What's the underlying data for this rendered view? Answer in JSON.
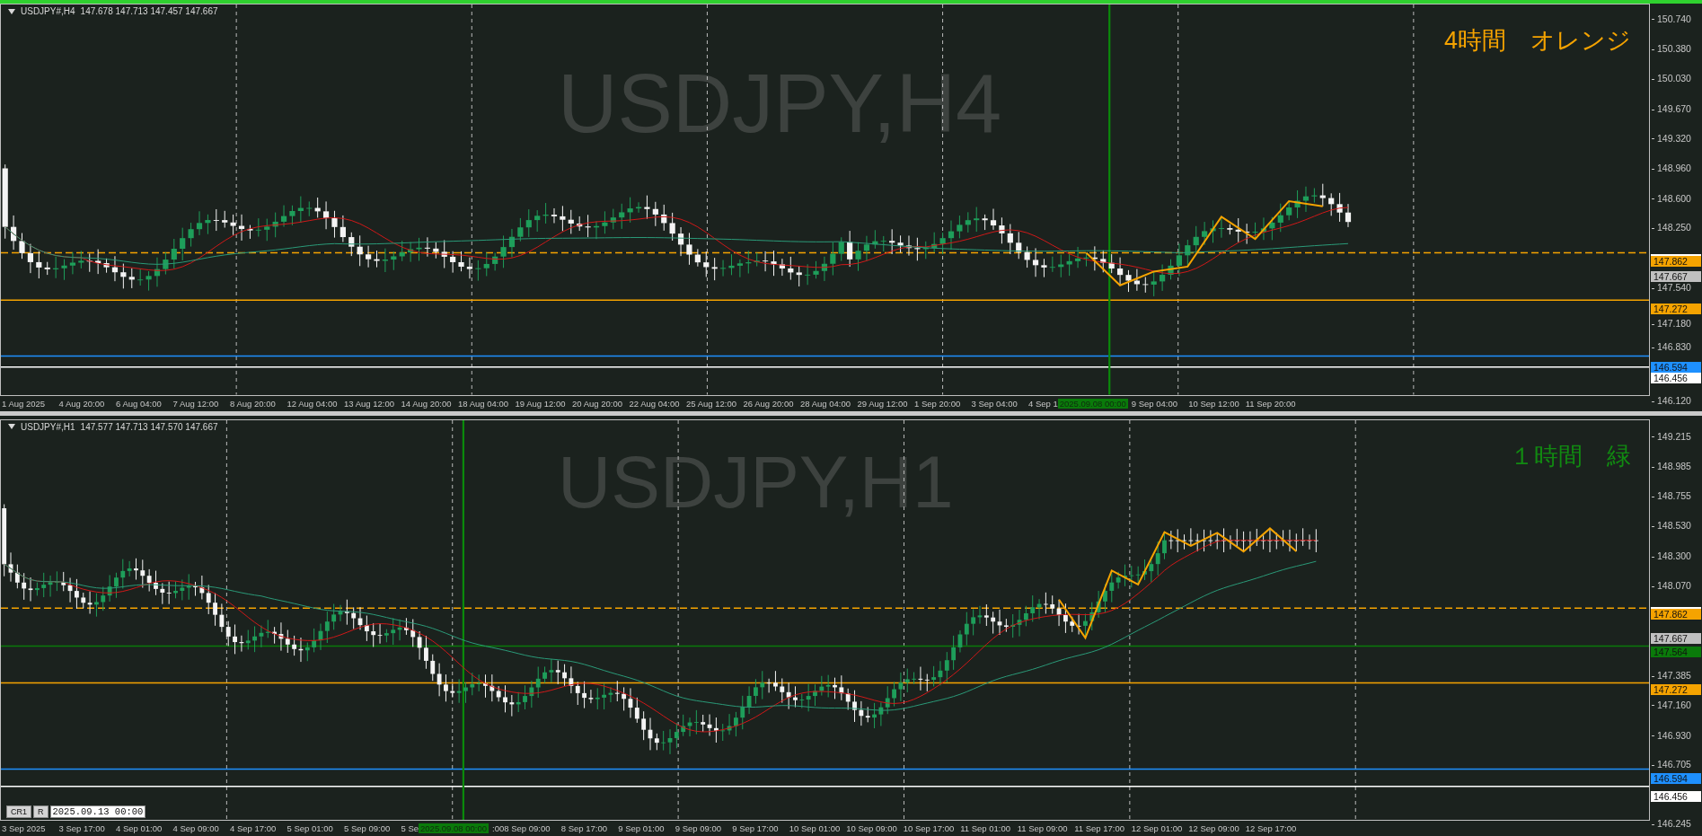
{
  "panels": [
    {
      "active": true,
      "symbol": "USDJPY#,H4",
      "ohlc": "147.678 147.713 147.457 147.667",
      "watermark": "USDJPY,H4",
      "note": {
        "text": "4時間　オレンジ",
        "color": "#f5a300"
      },
      "price_labels": [
        {
          "text": "150.740",
          "kind": "tick"
        },
        {
          "text": "150.380",
          "kind": "tick"
        },
        {
          "text": "150.030",
          "kind": "tick"
        },
        {
          "text": "149.670",
          "kind": "tick"
        },
        {
          "text": "149.320",
          "kind": "tick"
        },
        {
          "text": "148.960",
          "kind": "tick"
        },
        {
          "text": "148.600",
          "kind": "tick"
        },
        {
          "text": "148.250",
          "kind": "tick"
        },
        {
          "text": "147.862",
          "kind": "level",
          "color": "#f5a300",
          "dashed": true
        },
        {
          "text": "147.667",
          "kind": "price",
          "color": "#c0c0c0"
        },
        {
          "text": "147.540",
          "kind": "tick"
        },
        {
          "text": "147.272",
          "kind": "level",
          "color": "#f5a300",
          "dashed": false
        },
        {
          "text": "147.180",
          "kind": "tick"
        },
        {
          "text": "146.830",
          "kind": "tick"
        },
        {
          "text": "146.594",
          "kind": "level",
          "color": "#1e90ff",
          "dashed": false
        },
        {
          "text": "146.456",
          "kind": "level",
          "color": "#ffffff",
          "dashed": false
        },
        {
          "text": "146.120",
          "kind": "tick"
        }
      ],
      "time_labels": [
        {
          "text": "1 Aug 2025",
          "kind": "label"
        },
        {
          "text": "4 Aug 20:00",
          "kind": "label"
        },
        {
          "text": "6 Aug 04:00",
          "kind": "label"
        },
        {
          "text": "7 Aug 12:00",
          "kind": "label"
        },
        {
          "text": "8 Aug 20:00",
          "kind": "label"
        },
        {
          "text": "12 Aug 04:00",
          "kind": "label"
        },
        {
          "text": "13 Aug 12:00",
          "kind": "label"
        },
        {
          "text": "14 Aug 20:00",
          "kind": "label"
        },
        {
          "text": "18 Aug 04:00",
          "kind": "label"
        },
        {
          "text": "19 Aug 12:00",
          "kind": "label"
        },
        {
          "text": "20 Aug 20:00",
          "kind": "label"
        },
        {
          "text": "22 Aug 04:00",
          "kind": "label"
        },
        {
          "text": "25 Aug 12:00",
          "kind": "label"
        },
        {
          "text": "26 Aug 20:00",
          "kind": "label"
        },
        {
          "text": "28 Aug 04:00",
          "kind": "label"
        },
        {
          "text": "29 Aug 12:00",
          "kind": "label"
        },
        {
          "text": "1 Sep 20:00",
          "kind": "label"
        },
        {
          "text": "3 Sep 04:00",
          "kind": "label"
        },
        {
          "text": "4 Sep 1",
          "kind": "partial"
        },
        {
          "text": "2025.09.08 00:00",
          "kind": "marker"
        },
        {
          "text": "9 Sep 04:00",
          "kind": "label"
        },
        {
          "text": "10 Sep 12:00",
          "kind": "label"
        },
        {
          "text": "11 Sep 20:00",
          "kind": "label"
        }
      ]
    },
    {
      "active": false,
      "symbol": "USDJPY#,H1",
      "ohlc": "147.577 147.713 147.570 147.667",
      "watermark": "USDJPY,H1",
      "note": {
        "text": "１時間　緑",
        "color": "#118a11"
      },
      "price_labels": [
        {
          "text": "149.215",
          "kind": "tick"
        },
        {
          "text": "148.985",
          "kind": "tick"
        },
        {
          "text": "148.755",
          "kind": "tick"
        },
        {
          "text": "148.530",
          "kind": "tick"
        },
        {
          "text": "148.300",
          "kind": "tick"
        },
        {
          "text": "148.070",
          "kind": "tick"
        },
        {
          "text": "147.862",
          "kind": "level",
          "color": "#f5a300",
          "dashed": true
        },
        {
          "text": "147.667",
          "kind": "price",
          "color": "#c0c0c0"
        },
        {
          "text": "147.564",
          "kind": "level",
          "color": "#0a7a0a",
          "dashed": false
        },
        {
          "text": "147.385",
          "kind": "tick"
        },
        {
          "text": "147.272",
          "kind": "level",
          "color": "#f5a300",
          "dashed": false
        },
        {
          "text": "147.160",
          "kind": "tick"
        },
        {
          "text": "146.930",
          "kind": "tick"
        },
        {
          "text": "146.705",
          "kind": "tick"
        },
        {
          "text": "146.594",
          "kind": "level",
          "color": "#1e90ff",
          "dashed": false
        },
        {
          "text": "146.456",
          "kind": "level",
          "color": "#ffffff",
          "dashed": false
        },
        {
          "text": "146.245",
          "kind": "tick"
        }
      ],
      "time_labels": [
        {
          "text": "3 Sep 2025",
          "kind": "label"
        },
        {
          "text": "3 Sep 17:00",
          "kind": "label"
        },
        {
          "text": "4 Sep 01:00",
          "kind": "label"
        },
        {
          "text": "4 Sep 09:00",
          "kind": "label"
        },
        {
          "text": "4 Sep 17:00",
          "kind": "label"
        },
        {
          "text": "5 Sep 01:00",
          "kind": "label"
        },
        {
          "text": "5 Sep 09:00",
          "kind": "label"
        },
        {
          "text": "5 Se",
          "kind": "partial"
        },
        {
          "text": "2025.09.08 00:00",
          "kind": "marker"
        },
        {
          "text": ":00",
          "kind": "partial"
        },
        {
          "text": "8 Sep 09:00",
          "kind": "label"
        },
        {
          "text": "8 Sep 17:00",
          "kind": "label"
        },
        {
          "text": "9 Sep 01:00",
          "kind": "label"
        },
        {
          "text": "9 Sep 09:00",
          "kind": "label"
        },
        {
          "text": "9 Sep 17:00",
          "kind": "label"
        },
        {
          "text": "10 Sep 01:00",
          "kind": "label"
        },
        {
          "text": "10 Sep 09:00",
          "kind": "label"
        },
        {
          "text": "10 Sep 17:00",
          "kind": "label"
        },
        {
          "text": "11 Sep 01:00",
          "kind": "label"
        },
        {
          "text": "11 Sep 09:00",
          "kind": "label"
        },
        {
          "text": "11 Sep 17:00",
          "kind": "label"
        },
        {
          "text": "12 Sep 01:00",
          "kind": "label"
        },
        {
          "text": "12 Sep 09:00",
          "kind": "label"
        },
        {
          "text": "12 Sep 17:00",
          "kind": "label"
        }
      ],
      "toolbar": {
        "buttons": [
          "CR1",
          "R"
        ],
        "date_value": "2025.09.13 00:00"
      }
    }
  ]
}
